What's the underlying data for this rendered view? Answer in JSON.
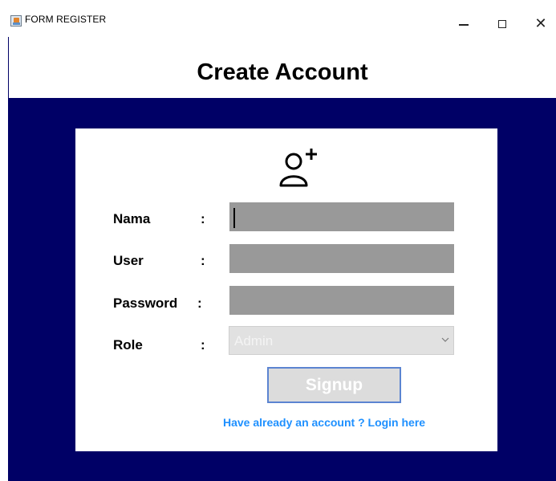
{
  "window": {
    "title": "FORM REGISTER",
    "minimize_icon": "minimize-icon",
    "maximize_icon": "maximize-icon",
    "close_icon": "close-icon",
    "close_glyph": "✕"
  },
  "header": {
    "title": "Create Account"
  },
  "form": {
    "icon": "user-add-icon",
    "fields": [
      {
        "label": "Nama",
        "colon": ":",
        "value": ""
      },
      {
        "label": "User",
        "colon": ":",
        "value": ""
      },
      {
        "label": "Password",
        "colon": ":",
        "value": ""
      }
    ],
    "role": {
      "label": "Role",
      "colon": ":",
      "selected": "Admin"
    },
    "signup_label": "Signup",
    "login_link": "Have already an account ? Login here"
  },
  "colors": {
    "background": "#000066",
    "field": "#999999",
    "link": "#1e90ff",
    "button_border": "#5b84d1"
  }
}
